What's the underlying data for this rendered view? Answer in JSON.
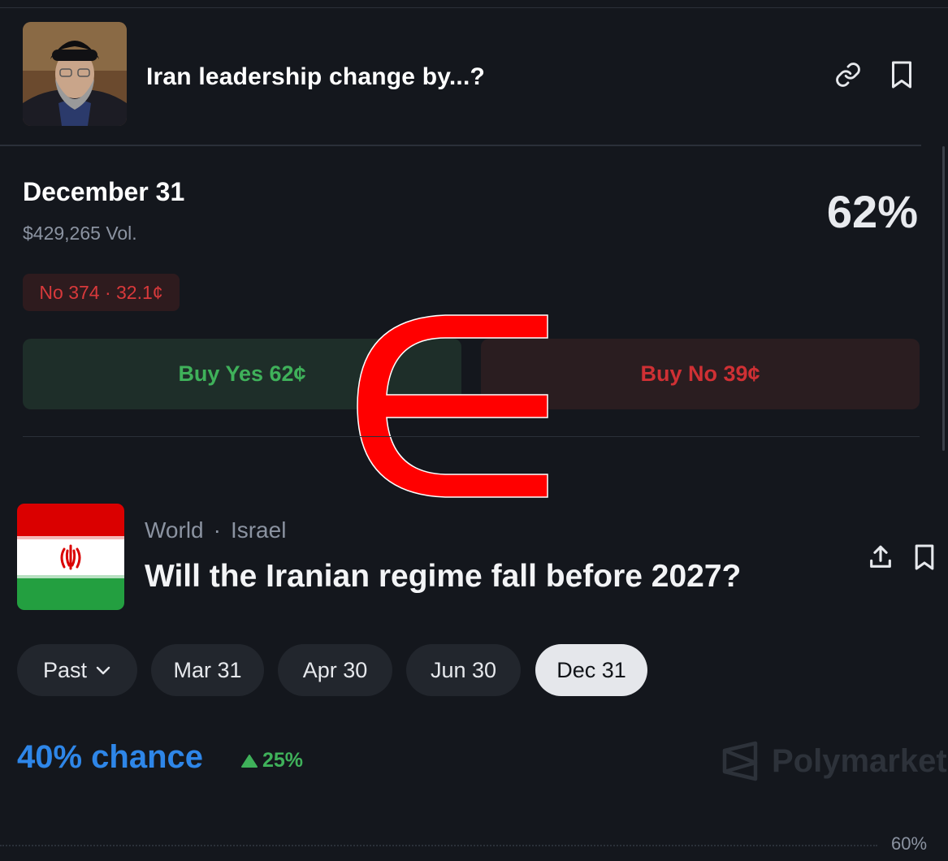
{
  "header": {
    "title": "Iran leadership change by...?",
    "avatar_icon": "person-photo"
  },
  "market": {
    "date": "December 31",
    "volume": "$429,265 Vol.",
    "percent": "62%",
    "position": "No 374 · 32.1¢",
    "buy_yes": "Buy Yes 62¢",
    "buy_no": "Buy No 39¢"
  },
  "event": {
    "category": "World",
    "tag": "Israel",
    "separator": "·",
    "title": "Will the Iranian regime fall before 2027?",
    "filters": [
      {
        "label": "Past",
        "selected": false
      },
      {
        "label": "Mar 31",
        "selected": false
      },
      {
        "label": "Apr 30",
        "selected": false
      },
      {
        "label": "Jun 30",
        "selected": false
      },
      {
        "label": "Dec 31",
        "selected": true
      }
    ],
    "chance": "40% chance",
    "change": "25%",
    "brand": "Polymarket",
    "axis_label": "60%"
  },
  "colors": {
    "background": "#14171d",
    "yes_green": "#3fb15a",
    "no_red": "#cf3034",
    "chance_blue": "#2e86e8",
    "overlay_red": "#ff0000"
  }
}
